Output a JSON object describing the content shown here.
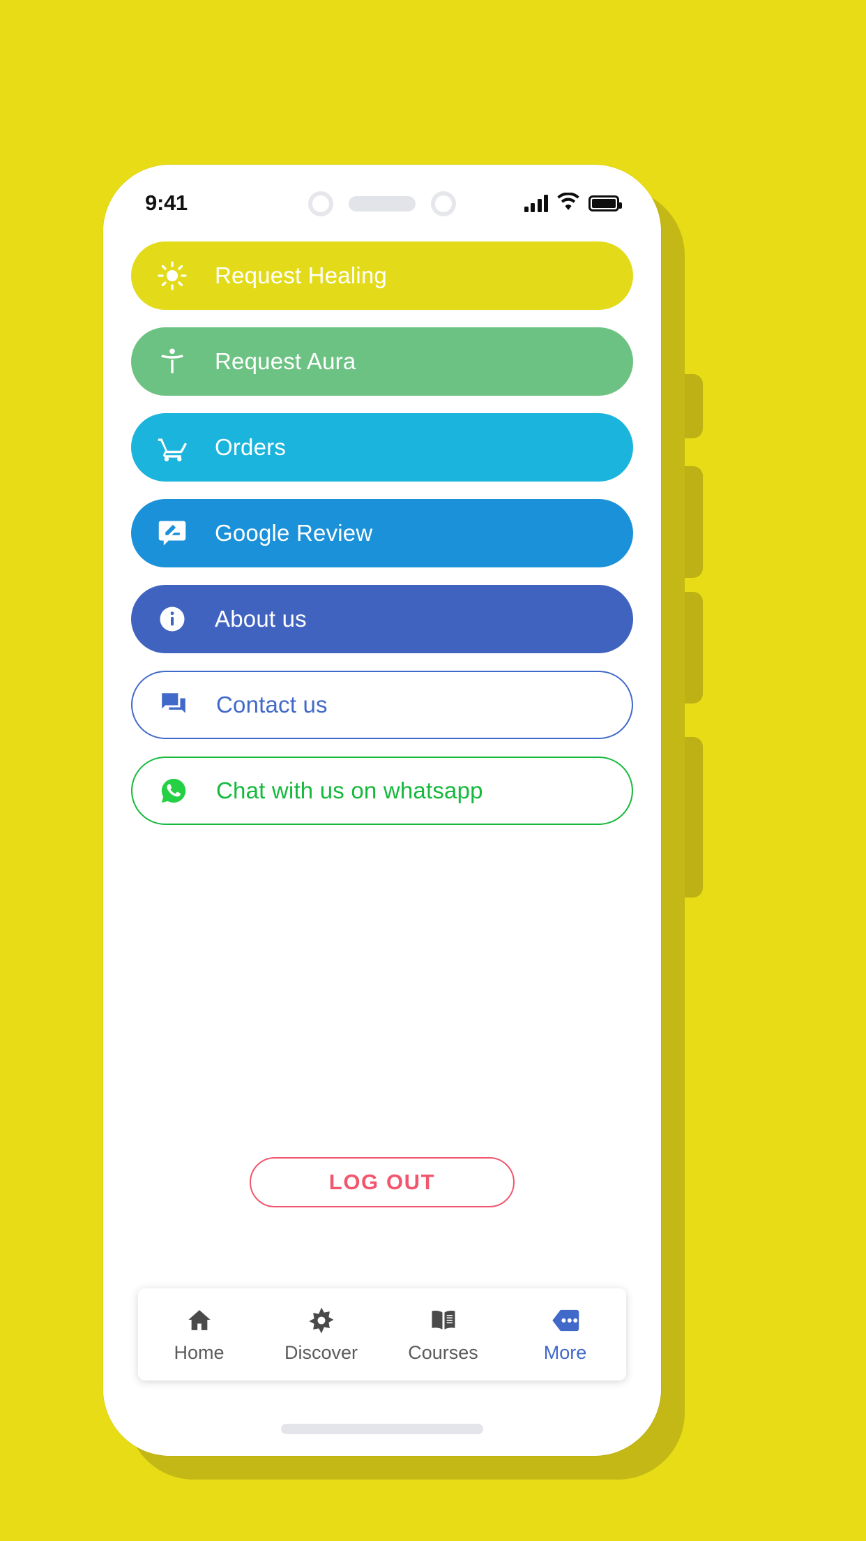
{
  "status_bar": {
    "time": "9:41",
    "signal_icon": "signal-bars-icon",
    "wifi_icon": "wifi-icon",
    "battery_icon": "battery-full-icon"
  },
  "menu": {
    "items": [
      {
        "label": "Request Healing",
        "icon": "brightness-sun-icon",
        "style": "filled",
        "bg": "#E3DB1A",
        "text_color": "#FFFFFF"
      },
      {
        "label": "Request Aura",
        "icon": "accessibility-person-icon",
        "style": "filled",
        "bg": "#6CC282",
        "text_color": "#FFFFFF"
      },
      {
        "label": "Orders",
        "icon": "shopping-cart-icon",
        "style": "filled",
        "bg": "#1BB4DC",
        "text_color": "#FFFFFF"
      },
      {
        "label": "Google Review",
        "icon": "rate-review-icon",
        "style": "filled",
        "bg": "#1A91D8",
        "text_color": "#FFFFFF"
      },
      {
        "label": "About us",
        "icon": "info-circle-icon",
        "style": "filled",
        "bg": "#4163C0",
        "text_color": "#FFFFFF"
      },
      {
        "label": "Contact us",
        "icon": "forum-chat-icon",
        "style": "outlined",
        "bg": "#FFFFFF",
        "text_color": "#4169C9"
      },
      {
        "label": "Chat with us on whatsapp",
        "icon": "whatsapp-icon",
        "style": "outlined",
        "bg": "#FFFFFF",
        "text_color": "#15B93C"
      }
    ]
  },
  "logout": {
    "label": "LOG OUT",
    "color": "#F2566E"
  },
  "bottom_nav": {
    "active_color": "#4169C9",
    "inactive_color": "#5B5B5B",
    "items": [
      {
        "label": "Home",
        "icon": "home-icon",
        "active": false
      },
      {
        "label": "Discover",
        "icon": "flower-star-icon",
        "active": false
      },
      {
        "label": "Courses",
        "icon": "open-book-icon",
        "active": false
      },
      {
        "label": "More",
        "icon": "more-dots-icon",
        "active": true
      }
    ]
  },
  "background": {
    "color": "#E8DC16"
  }
}
